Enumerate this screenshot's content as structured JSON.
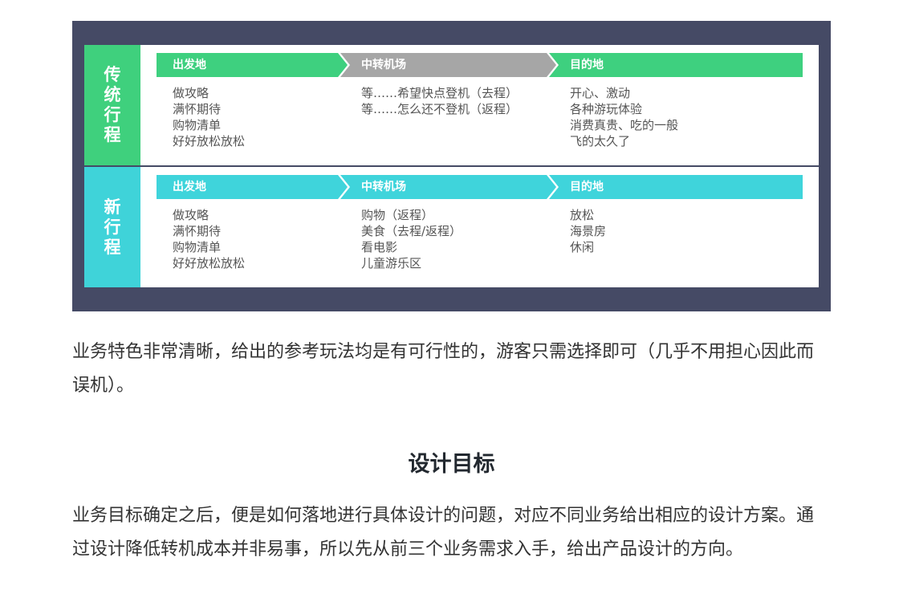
{
  "figure": {
    "colors": {
      "frame": "#454a65",
      "green": "#3ed07f",
      "cyan": "#3fd4db",
      "gray": "#a6a6a6"
    },
    "rows": [
      {
        "label": [
          "传",
          "统",
          "行",
          "程"
        ],
        "stages": [
          "出发地",
          "中转机场",
          "目的地"
        ],
        "columns": [
          [
            "做攻略",
            "满怀期待",
            "购物清单",
            "好好放松放松"
          ],
          [
            "等……希望快点登机（去程）",
            "等……怎么还不登机（返程）"
          ],
          [
            "开心、激动",
            "各种游玩体验",
            "消费真贵、吃的一般",
            "飞的太久了"
          ]
        ]
      },
      {
        "label": [
          "新",
          "行",
          "程"
        ],
        "stages": [
          "出发地",
          "中转机场",
          "目的地"
        ],
        "columns": [
          [
            "做攻略",
            "满怀期待",
            "购物清单",
            "好好放松放松"
          ],
          [
            "购物（返程）",
            "美食（去程/返程）",
            "看电影",
            "儿童游乐区"
          ],
          [
            "放松",
            "海景房",
            "休闲"
          ]
        ]
      }
    ]
  },
  "paragraph1": "业务特色非常清晰，给出的参考玩法均是有可行性的，游客只需选择即可（几乎不用担心因此而误机）。",
  "heading": "设计目标",
  "paragraph2": "业务目标确定之后，便是如何落地进行具体设计的问题，对应不同业务给出相应的设计方案。通过设计降低转机成本并非易事，所以先从前三个业务需求入手，给出产品设计的方向。"
}
